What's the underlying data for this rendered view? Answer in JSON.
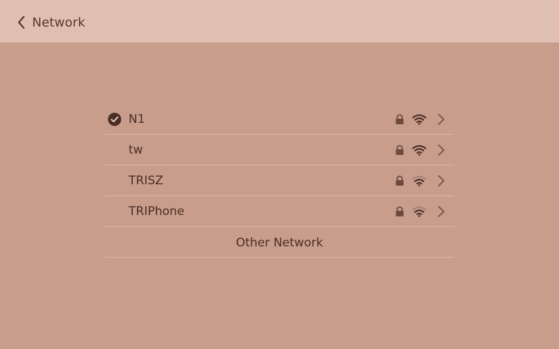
{
  "header": {
    "title": "Network",
    "back_icon": "chevron-left-icon"
  },
  "networks": [
    {
      "name": "N1",
      "connected": true,
      "secured": true,
      "signal": "full"
    },
    {
      "name": "tw",
      "connected": false,
      "secured": true,
      "signal": "full"
    },
    {
      "name": "TRISZ",
      "connected": false,
      "secured": true,
      "signal": "medium"
    },
    {
      "name": "TRIPhone",
      "connected": false,
      "secured": true,
      "signal": "medium"
    }
  ],
  "other_network": {
    "label": "Other Network"
  },
  "colors": {
    "background": "#c99d8c",
    "header_background": "#dfbfb0",
    "text": "#4a2e26",
    "icon": "#6b4a40",
    "divider": "#dbb6a8"
  }
}
